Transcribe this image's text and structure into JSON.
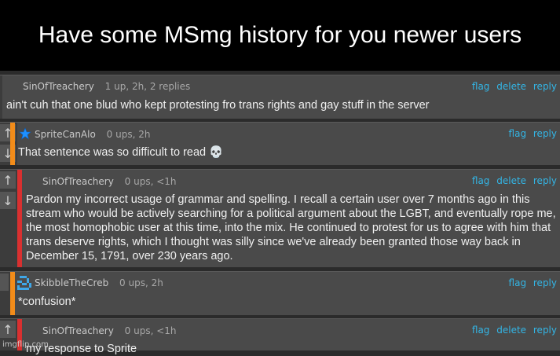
{
  "title": "Have some MSmg history for you newer users",
  "watermark": "imgflip.com",
  "colors": {
    "accent_orange": "#f28c1a",
    "accent_red": "#d93030",
    "link": "#33b5e5"
  },
  "vote_icons": {
    "up": "↑",
    "down": "↓"
  },
  "comments": [
    {
      "user": "SinOfTreachery",
      "stats": "1 up, 2h, 2 replies",
      "actions": [
        "flag",
        "delete",
        "reply"
      ],
      "text": "ain't cuh that one blud who kept protesting fro trans rights and gay stuff in the server"
    },
    {
      "user": "SpriteCanAlo",
      "stats": "0 ups, 2h",
      "actions": [
        "flag",
        "reply"
      ],
      "text": "That sentence was so difficult to read 💀",
      "avatar_icon": "star-icon"
    },
    {
      "user": "SinOfTreachery",
      "stats": "0 ups, <1h",
      "actions": [
        "flag",
        "delete",
        "reply"
      ],
      "text": "Pardon my incorrect usage of grammar and spelling. I recall a certain user over 7 months ago in this stream who would be actively searching for a political argument about the LGBT, and eventually rope me, the most homophobic user at this time, into the mix. He continued to protest for us to agree with him that trans deserve rights, which I thought was silly since we've already been granted those way back in December 15, 1791, over 230 years ago."
    },
    {
      "user": "SkibbleTheCreb",
      "stats": "0 ups, 2h",
      "actions": [
        "flag",
        "reply"
      ],
      "text": "*confusion*",
      "avatar_icon": "pixel-avatar-icon"
    },
    {
      "user": "SinOfTreachery",
      "stats": "0 ups, <1h",
      "actions": [
        "flag",
        "delete",
        "reply"
      ],
      "text": "my response to Sprite"
    }
  ]
}
